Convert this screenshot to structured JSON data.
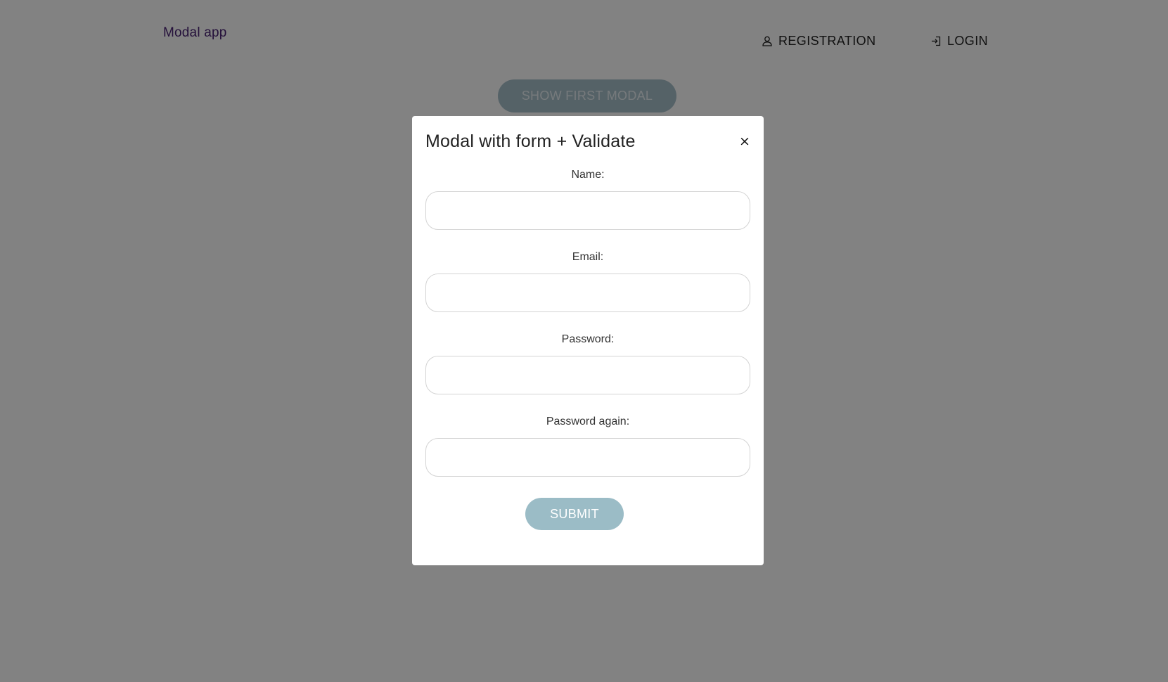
{
  "app": {
    "brand": "Modal app"
  },
  "nav": {
    "registration_label": "REGISTRATION",
    "registration_icon": "user-icon",
    "login_label": "LOGIN",
    "login_icon": "login-icon"
  },
  "main": {
    "show_modal_label": "SHOW FIRST MODAL"
  },
  "modal": {
    "title": "Modal with form + Validate",
    "close_label": "×",
    "fields": [
      {
        "label": "Name:",
        "value": "",
        "placeholder": ""
      },
      {
        "label": "Email:",
        "value": "",
        "placeholder": ""
      },
      {
        "label": "Password:",
        "value": "",
        "placeholder": ""
      },
      {
        "label": "Password again:",
        "value": "",
        "placeholder": ""
      }
    ],
    "submit_label": "SUBMIT"
  },
  "colors": {
    "brand": "#4a2375",
    "primary_button": "#9bbcc6",
    "overlay": "rgba(0,0,0,0.49)"
  }
}
